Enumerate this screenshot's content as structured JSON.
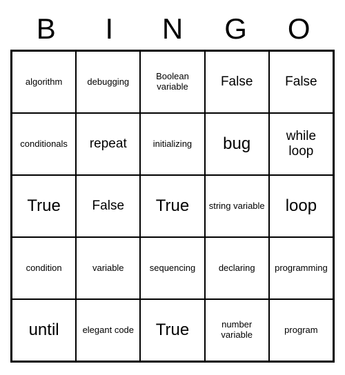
{
  "header": [
    "B",
    "I",
    "N",
    "G",
    "O"
  ],
  "cells": [
    [
      {
        "text": "algorithm",
        "size": "sm"
      },
      {
        "text": "debugging",
        "size": "sm"
      },
      {
        "text": "Boolean variable",
        "size": "sm"
      },
      {
        "text": "False",
        "size": "md"
      },
      {
        "text": "False",
        "size": "md"
      }
    ],
    [
      {
        "text": "conditionals",
        "size": "sm"
      },
      {
        "text": "repeat",
        "size": "md"
      },
      {
        "text": "initializing",
        "size": "sm"
      },
      {
        "text": "bug",
        "size": "lg"
      },
      {
        "text": "while loop",
        "size": "md"
      }
    ],
    [
      {
        "text": "True",
        "size": "lg"
      },
      {
        "text": "False",
        "size": "md"
      },
      {
        "text": "True",
        "size": "lg"
      },
      {
        "text": "string variable",
        "size": "sm"
      },
      {
        "text": "loop",
        "size": "lg"
      }
    ],
    [
      {
        "text": "condition",
        "size": "sm"
      },
      {
        "text": "variable",
        "size": "sm"
      },
      {
        "text": "sequencing",
        "size": "sm"
      },
      {
        "text": "declaring",
        "size": "sm"
      },
      {
        "text": "programming",
        "size": "sm"
      }
    ],
    [
      {
        "text": "until",
        "size": "lg"
      },
      {
        "text": "elegant code",
        "size": "sm"
      },
      {
        "text": "True",
        "size": "lg"
      },
      {
        "text": "number variable",
        "size": "sm"
      },
      {
        "text": "program",
        "size": "sm"
      }
    ]
  ]
}
